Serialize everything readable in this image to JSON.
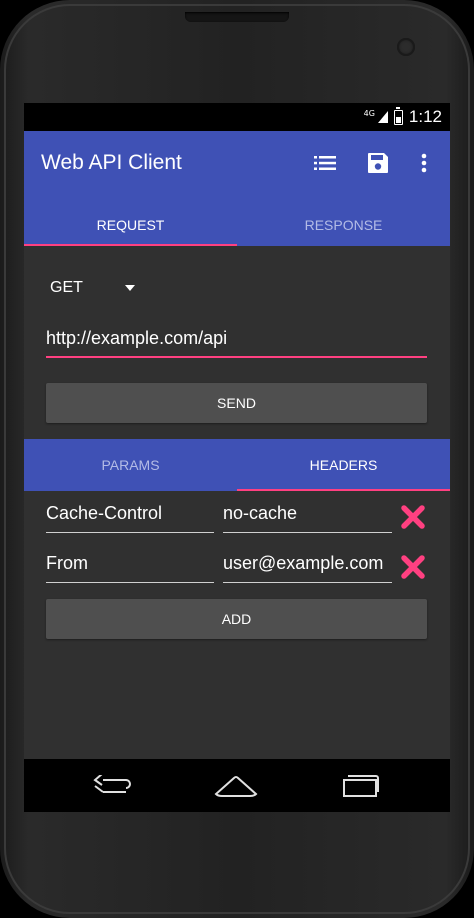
{
  "status_bar": {
    "network": "4G",
    "time": "1:12"
  },
  "app_bar": {
    "title": "Web API Client",
    "actions": [
      "list-icon",
      "save-icon",
      "more-vert-icon"
    ]
  },
  "main_tabs": [
    {
      "label": "REQUEST",
      "active": true
    },
    {
      "label": "RESPONSE",
      "active": false
    }
  ],
  "request": {
    "method": "GET",
    "url": "http://example.com/api",
    "send_label": "SEND"
  },
  "sub_tabs": [
    {
      "label": "PARAMS",
      "active": false
    },
    {
      "label": "HEADERS",
      "active": true
    }
  ],
  "headers": [
    {
      "key": "Cache-Control",
      "value": "no-cache"
    },
    {
      "key": "From",
      "value": "user@example.com"
    }
  ],
  "add_label": "ADD",
  "colors": {
    "primary": "#3f51b5",
    "accent": "#ff4081",
    "background": "#303030",
    "button": "#4f4f4f"
  },
  "nav_bar": [
    "back-icon",
    "home-icon",
    "recents-icon"
  ]
}
